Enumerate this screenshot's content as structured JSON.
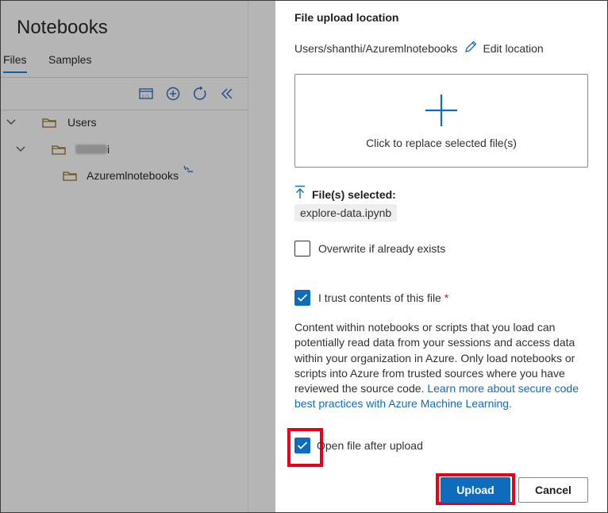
{
  "sidebar": {
    "title": "Notebooks",
    "tabs": [
      {
        "label": "Files",
        "active": true
      },
      {
        "label": "Samples",
        "active": false
      }
    ],
    "toolbar_icons": [
      "terminal-icon",
      "add-icon",
      "refresh-icon",
      "collapse-icon"
    ],
    "tree": [
      {
        "label": "Users"
      },
      {
        "label": "i"
      },
      {
        "label": "Azuremlnotebooks"
      }
    ]
  },
  "dialog": {
    "upload_location_label": "File upload location",
    "upload_location_path": "Users/shanthi/Azuremlnotebooks",
    "edit_location_label": "Edit location",
    "dropzone_text": "Click to replace selected file(s)",
    "files_selected_label": "File(s) selected:",
    "selected_file": "explore-data.ipynb",
    "overwrite_label": "Overwrite if already exists",
    "overwrite_checked": false,
    "trust_label": "I trust contents of this file",
    "trust_required_mark": "*",
    "trust_checked": true,
    "description": "Content within notebooks or scripts that you load can potentially read data from your sessions and access data within your organization in Azure. Only load notebooks or scripts into Azure from trusted sources where you have reviewed the source code.",
    "learn_more_link": "Learn more about secure code best practices with Azure Machine Learning.",
    "open_after_label": "Open file after upload",
    "open_after_checked": true,
    "upload_button": "Upload",
    "cancel_button": "Cancel"
  },
  "colors": {
    "accent": "#0f6cbd",
    "highlight": "#e8001c",
    "overlay": "#b5b5b5"
  }
}
